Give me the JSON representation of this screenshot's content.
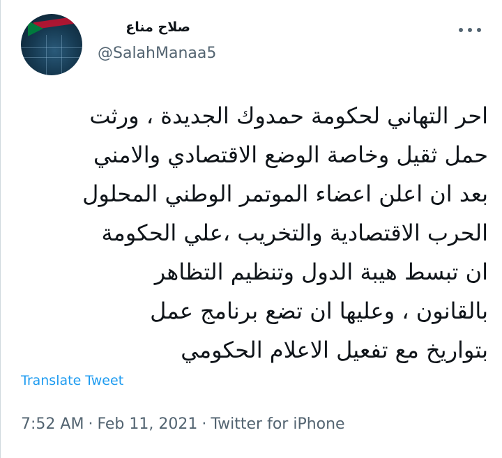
{
  "author": {
    "display_name": "صلاح مناع",
    "handle": "@SalahManaa5"
  },
  "tweet": {
    "lines": [
      "احر  التهاني لحكومة حمدوك الجديدة ، ورثت",
      "حمل ثقيل وخاصة الوضع الاقتصادي والامني",
      "بعد ان اعلن اعضاء الموتمر الوطني المحلول",
      "الحرب الاقتصادية والتخريب ،علي الحكومة",
      "ان تبسط هيبة الدول  وتنظيم التظاهر",
      "بالقانون ، وعليها ان تضع برنامج عمل",
      "بتواريخ   مع تفعيل الاعلام الحكومي"
    ]
  },
  "actions": {
    "translate_label": "Translate Tweet",
    "more_icon": "more-horizontal-icon"
  },
  "meta": {
    "time": "7:52 AM",
    "separator": "·",
    "date": "Feb 11, 2021",
    "source": "Twitter for iPhone"
  },
  "colors": {
    "text_primary": "#0f1419",
    "text_secondary": "#536471",
    "link": "#1d9bf0"
  }
}
